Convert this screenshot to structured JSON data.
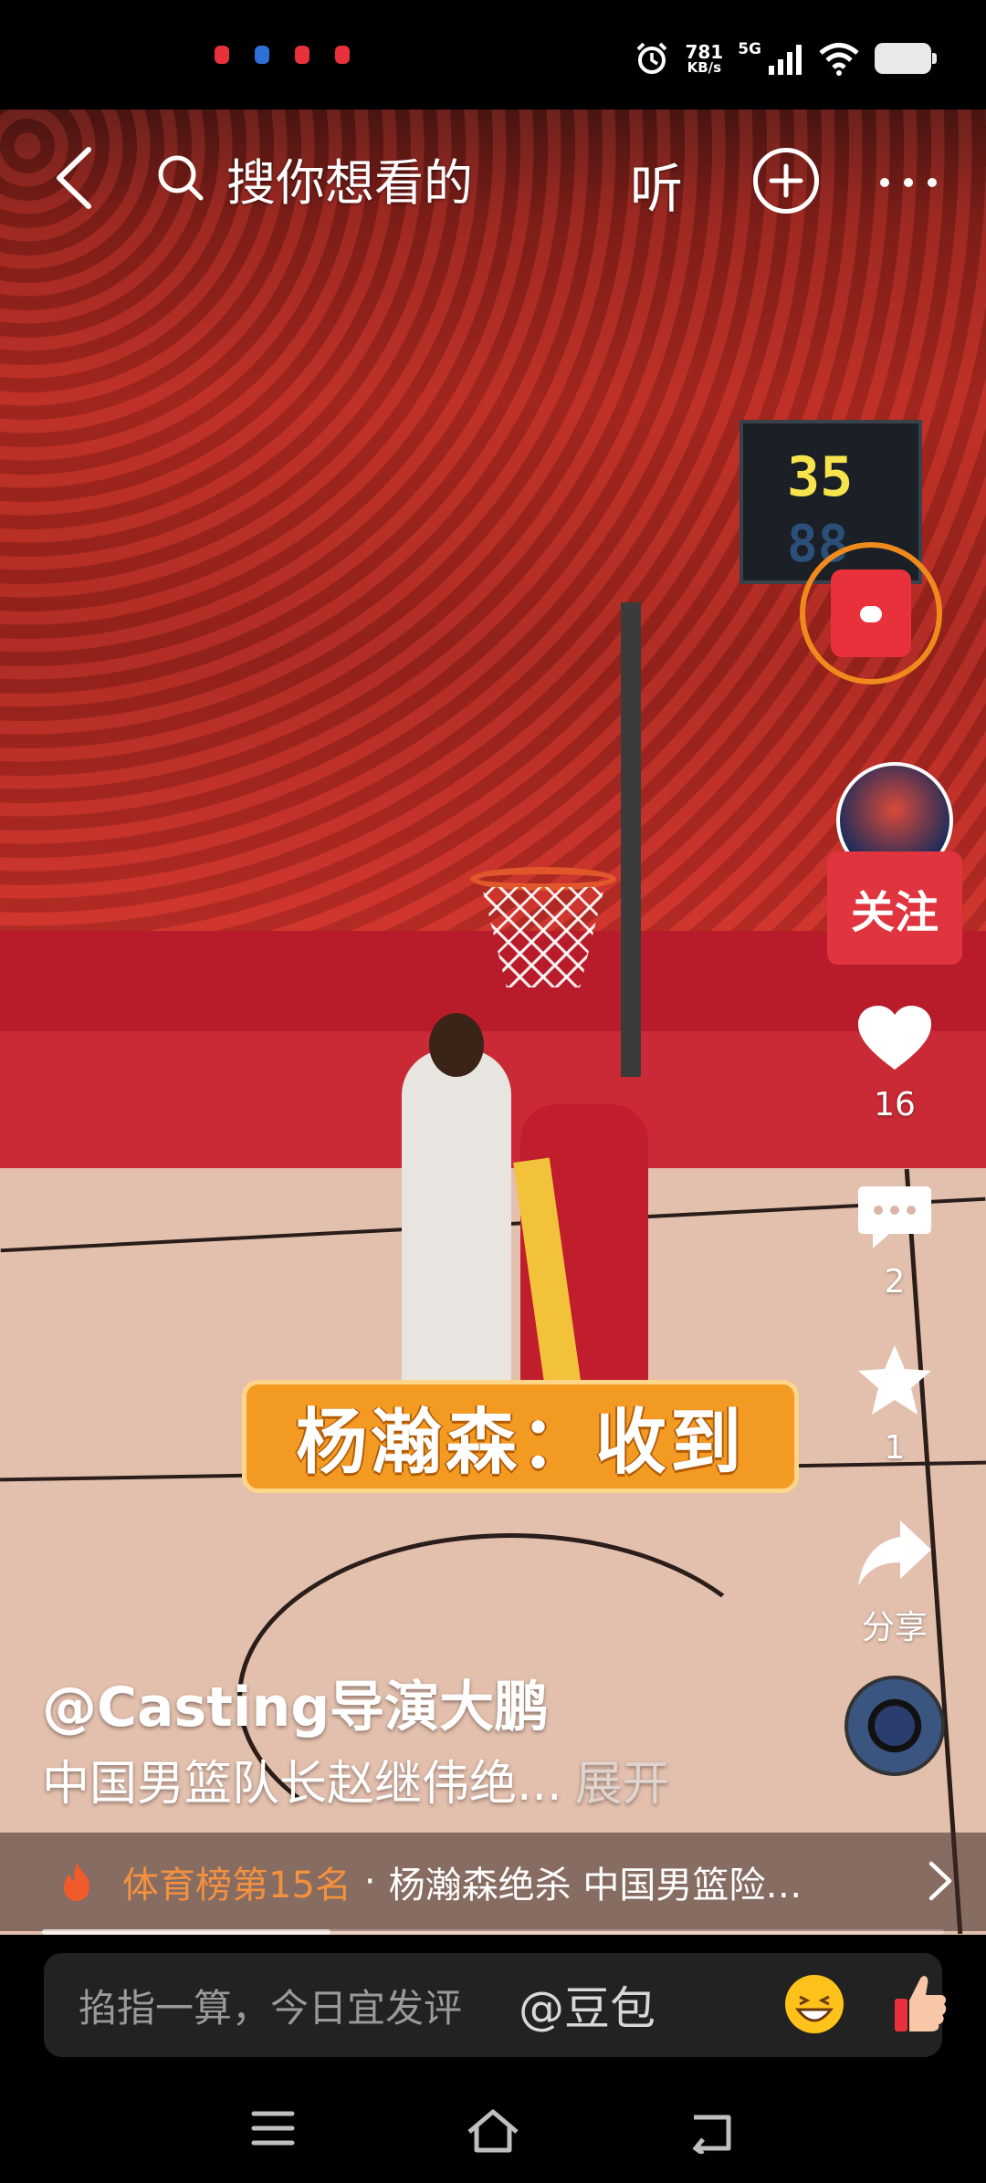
{
  "status_bar": {
    "net_speed_value": "781",
    "net_speed_unit": "KB/s",
    "signal_type": "5G",
    "notif_dot_colors": [
      "#e8313b",
      "#2f6fd8",
      "#e8313b",
      "#e8313b"
    ]
  },
  "top_bar": {
    "search_placeholder": "搜你想看的",
    "listen_label": "听"
  },
  "video": {
    "scoreboard_value": "35",
    "caption": "杨瀚森：收到"
  },
  "right_rail": {
    "follow_label": "关注",
    "like_count": "16",
    "comment_count": "2",
    "favorite_count": "1",
    "share_label": "分享"
  },
  "post": {
    "author": "@Casting导演大鹏",
    "description": "中国男篮队长赵继伟绝...",
    "expand_label": "展开"
  },
  "hot_bar": {
    "rank": "体育榜第15名",
    "separator": "·",
    "title": "杨瀚森绝杀 中国男篮险…"
  },
  "playback": {
    "progress": 0.32
  },
  "comment_bar": {
    "placeholder": "掐指一算，今日宜发评",
    "mention": "@豆包"
  },
  "colors": {
    "accent_red": "#e0353e",
    "hot_orange": "#f4913f",
    "caption_orange": "#f39a23"
  }
}
